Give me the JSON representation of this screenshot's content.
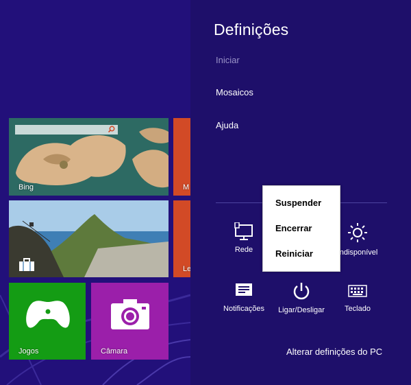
{
  "settings": {
    "title": "Definições",
    "links": {
      "iniciar": "Iniciar",
      "mosaicos": "Mosaicos",
      "ajuda": "Ajuda"
    },
    "tray": {
      "rede": "Rede",
      "brilho": "Indisponível",
      "notificacoes": "Notificações",
      "ligar": "Ligar/Desligar",
      "teclado": "Teclado"
    },
    "change_pc_settings": "Alterar definições do PC"
  },
  "power_menu": {
    "items": [
      "Suspender",
      "Encerrar",
      "Reiniciar"
    ]
  },
  "tiles": {
    "bing": "Bing",
    "partial_1": "M",
    "partial_2": "Le",
    "jogos": "Jogos",
    "camara": "Câmara"
  },
  "colors": {
    "background": "#1e0f6a",
    "start_background": "#22107a",
    "tile_green": "#149c14",
    "tile_purple": "#9b1faa",
    "tile_orange": "#d24a26",
    "menu_background": "#ffffff",
    "inactive_link": "#9a93c8"
  },
  "icons": {
    "rede": "network-icon",
    "brilho": "brightness-icon",
    "notificacoes": "notifications-icon",
    "ligar": "power-icon",
    "teclado": "keyboard-icon",
    "bing_search": "search-icon",
    "jogos": "gamepad-icon",
    "camara": "camera-icon",
    "travel": "suitcase-icon"
  }
}
